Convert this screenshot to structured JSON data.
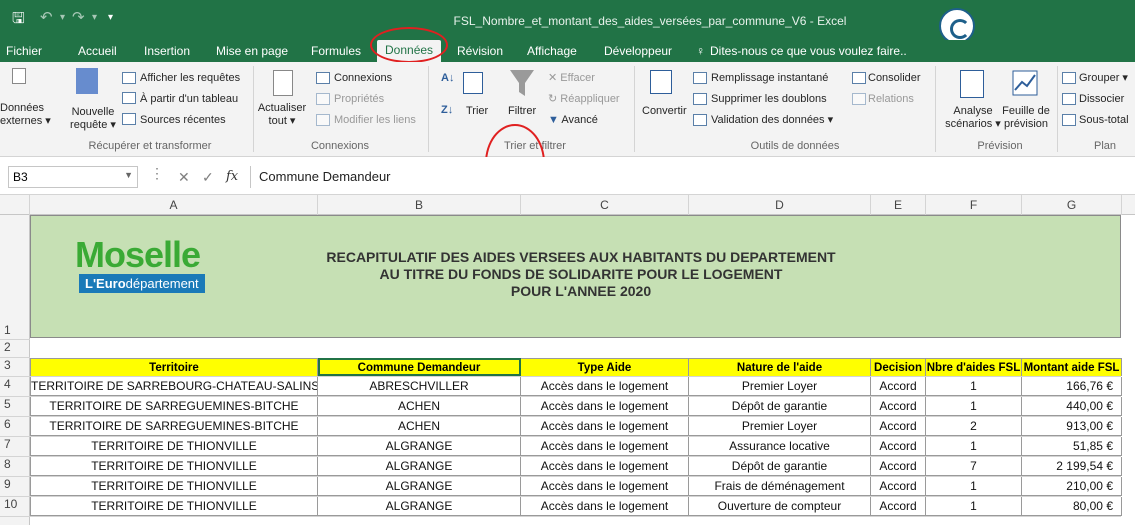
{
  "title_bar": {
    "document_title": "FSL_Nombre_et_montant_des_aides_versées_par_commune_V6 - Excel"
  },
  "tabs": [
    "Fichier",
    "Accueil",
    "Insertion",
    "Mise en page",
    "Formules",
    "Données",
    "Révision",
    "Affichage",
    "Développeur"
  ],
  "active_tab": "Données",
  "tell_me": "Dites-nous ce que vous voulez faire..",
  "ribbon": {
    "donnees_externes": [
      "Données",
      "externes ▾"
    ],
    "nouvelle_requete": [
      "Nouvelle",
      "requête ▾"
    ],
    "afficher_requetes": "Afficher les requêtes",
    "partir_tableau": "À partir d'un tableau",
    "sources_recentes": "Sources récentes",
    "group_recuperer": "Récupérer et transformer",
    "actualiser": [
      "Actualiser",
      "tout ▾"
    ],
    "connexions": "Connexions",
    "proprietes": "Propriétés",
    "modifier_liens": "Modifier les liens",
    "group_connexions": "Connexions",
    "trier": "Trier",
    "filtrer": "Filtrer",
    "effacer": "Effacer",
    "reappliquer": "Réappliquer",
    "avance": "Avancé",
    "group_trier": "Trier et filtrer",
    "convertir": "Convertir",
    "remplissage": "Remplissage instantané",
    "supprimer_doublons": "Supprimer les doublons",
    "validation": "Validation des données ▾",
    "consolider": "Consolider",
    "relations": "Relations",
    "group_outils": "Outils de données",
    "analyse": [
      "Analyse",
      "scénarios ▾"
    ],
    "feuille": [
      "Feuille de",
      "prévision"
    ],
    "group_prevision": "Prévision",
    "grouper": "Grouper ▾",
    "dissocier": "Dissocier",
    "sous_total": "Sous-total",
    "group_plan": "Plan"
  },
  "formula_bar": {
    "name_box": "B3",
    "fx": "fx",
    "content": "Commune Demandeur"
  },
  "columns": [
    "A",
    "B",
    "C",
    "D",
    "E",
    "F",
    "G"
  ],
  "row_numbers": [
    "1",
    "2",
    "3",
    "4",
    "5",
    "6",
    "7",
    "8",
    "9",
    "10"
  ],
  "banner": {
    "logo_main": "Moselle",
    "logo_sub_bold": "L'Euro",
    "logo_sub_rest": "département",
    "title_lines": [
      "RECAPITULATIF DES AIDES VERSEES AUX HABITANTS DU DEPARTEMENT",
      "AU TITRE DU FONDS DE SOLIDARITE POUR LE LOGEMENT",
      "POUR L'ANNEE 2020"
    ]
  },
  "table": {
    "headers": [
      "Territoire",
      "Commune Demandeur",
      "Type Aide",
      "Nature de l'aide",
      "Decision",
      "Nbre d'aides FSL",
      "Montant aide FSL"
    ],
    "rows": [
      [
        "TERRITOIRE DE SARREBOURG-CHATEAU-SALINS",
        "ABRESCHVILLER",
        "Accès dans le logement",
        "Premier Loyer",
        "Accord",
        "1",
        "166,76 €"
      ],
      [
        "TERRITOIRE DE SARREGUEMINES-BITCHE",
        "ACHEN",
        "Accès dans le logement",
        "Dépôt de garantie",
        "Accord",
        "1",
        "440,00 €"
      ],
      [
        "TERRITOIRE DE SARREGUEMINES-BITCHE",
        "ACHEN",
        "Accès dans le logement",
        "Premier Loyer",
        "Accord",
        "2",
        "913,00 €"
      ],
      [
        "TERRITOIRE DE THIONVILLE",
        "ALGRANGE",
        "Accès dans le logement",
        "Assurance locative",
        "Accord",
        "1",
        "51,85 €"
      ],
      [
        "TERRITOIRE DE THIONVILLE",
        "ALGRANGE",
        "Accès dans le logement",
        "Dépôt de garantie",
        "Accord",
        "7",
        "2 199,54 €"
      ],
      [
        "TERRITOIRE DE THIONVILLE",
        "ALGRANGE",
        "Accès dans le logement",
        "Frais de déménagement",
        "Accord",
        "1",
        "210,00 €"
      ],
      [
        "TERRITOIRE DE THIONVILLE",
        "ALGRANGE",
        "Accès dans le logement",
        "Ouverture de compteur",
        "Accord",
        "1",
        "80,00 €"
      ]
    ]
  },
  "colors": {
    "excel_green": "#217346",
    "banner_green": "#c6e0b4",
    "header_yellow": "#ffff00",
    "annotation_red": "#e02020"
  }
}
